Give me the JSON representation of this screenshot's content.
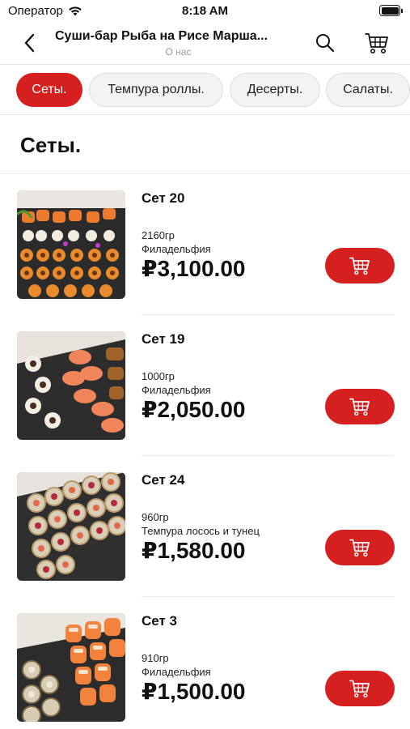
{
  "status_bar": {
    "carrier": "Оператор",
    "time": "8:18 AM"
  },
  "nav": {
    "title": "Суши-бар Рыба на Рисе Марша...",
    "subtitle": "О нас"
  },
  "tabs": [
    {
      "label": "Сеты.",
      "active": true
    },
    {
      "label": "Темпура роллы.",
      "active": false
    },
    {
      "label": "Десерты.",
      "active": false
    },
    {
      "label": "Салаты.",
      "active": false
    }
  ],
  "section": {
    "title": "Сеты."
  },
  "products": [
    {
      "name": "Сет 20",
      "weight": "2160гр",
      "description": "Филадельфия",
      "price": "₽3,100.00"
    },
    {
      "name": "Сет 19",
      "weight": "1000гр",
      "description": "Филадельфия",
      "price": "₽2,050.00"
    },
    {
      "name": "Сет 24",
      "weight": "960гр",
      "description": "Темпура лосось и тунец",
      "price": "₽1,580.00"
    },
    {
      "name": "Сет 3",
      "weight": "910гр",
      "description": "Филадельфия",
      "price": "₽1,500.00"
    }
  ],
  "colors": {
    "accent": "#d61f1f",
    "tab_inactive_bg": "#f3f3f3",
    "subtitle_gray": "#9a9a9a"
  },
  "icons": {
    "back": "chevron-left-icon",
    "search": "search-icon",
    "cart": "cart-icon",
    "add_to_cart": "cart-icon"
  }
}
